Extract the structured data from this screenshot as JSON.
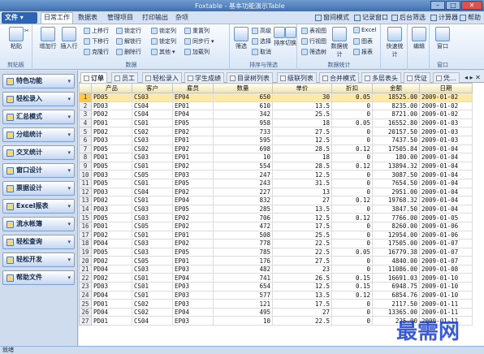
{
  "window": {
    "title": "Foxtable - 基本功能演示Table"
  },
  "menu": {
    "file": "文件",
    "tabs": [
      "日常工作",
      "数据表",
      "管理项目",
      "打印输出",
      "杂项"
    ],
    "right": [
      "窗间模式",
      "记录窗口",
      "后台筛选",
      "计算器",
      "帮助"
    ]
  },
  "ribbon": {
    "clipboard": {
      "paste": "粘贴",
      "label": "剪贴板"
    },
    "data": {
      "add_row": "增加行",
      "insert_row": "插入行",
      "move_up": "上移行",
      "move_down": "下移行",
      "copy_row": "克隆行",
      "lock_row": "锁定行",
      "unlock_row": "解锁行",
      "delete_row": "删除行",
      "lock_col": "锁定列",
      "freeze": "锁定列",
      "other": "其他",
      "reset_col": "重置列",
      "sync": "同步行",
      "encrypt": "加载列",
      "label": "数据"
    },
    "sort_filter": {
      "filter": "筛选",
      "advanced": "高级",
      "select": "选择",
      "cancel": "取消",
      "sort": "排序",
      "switch": "切换",
      "label": "排序与筛选"
    },
    "stats": {
      "table_view": "表视图",
      "row_view": "行视图",
      "filter_tree": "筛选树",
      "data_stats": "数据统计",
      "excel": "Excel",
      "chart": "图表",
      "report": "报表",
      "quick_stats": "快速统计",
      "label": "数据统计"
    },
    "edit": {
      "edit": "编辑"
    },
    "window": {
      "window": "窗口",
      "label": "窗口"
    }
  },
  "sidebar": {
    "items": [
      "特色功能",
      "轻松录入",
      "汇总模式",
      "分组统计",
      "交叉统计",
      "窗口设计",
      "票据设计",
      "Excel报表",
      "流水帐簿",
      "轻松查询",
      "轻松开发",
      "帮助文件"
    ]
  },
  "tables": {
    "tabs": [
      "订单",
      "员工",
      "轻松录入",
      "学生成绩",
      "目录树列表",
      "级联列表",
      "合并模式",
      "多层表头",
      "凭证",
      "凭..."
    ]
  },
  "grid": {
    "columns": [
      "产品",
      "客户",
      "雇员",
      "数量",
      "单价",
      "折扣",
      "金额",
      "日期"
    ],
    "rows": [
      [
        "PD05",
        "CS03",
        "EP04",
        "650",
        "30",
        "0.05",
        "18525.00",
        "2009-01-02"
      ],
      [
        "PD03",
        "CS04",
        "EP01",
        "610",
        "13.5",
        "0",
        "8235.00",
        "2009-01-02"
      ],
      [
        "PD02",
        "CS04",
        "EP04",
        "342",
        "25.5",
        "0",
        "8721.00",
        "2009-01-02"
      ],
      [
        "PD01",
        "CS01",
        "EP05",
        "958",
        "18",
        "0.05",
        "16552.80",
        "2009-01-03"
      ],
      [
        "PD02",
        "CS02",
        "EP02",
        "733",
        "27.5",
        "0",
        "20157.50",
        "2009-01-03"
      ],
      [
        "PD03",
        "CS03",
        "EP01",
        "595",
        "12.5",
        "0",
        "7437.50",
        "2009-01-03"
      ],
      [
        "PD05",
        "CS02",
        "EP02",
        "698",
        "28.5",
        "0.12",
        "17505.84",
        "2009-01-04"
      ],
      [
        "PD01",
        "CS03",
        "EP01",
        "10",
        "18",
        "0",
        "180.00",
        "2009-01-04"
      ],
      [
        "PD05",
        "CS01",
        "EP02",
        "554",
        "28.5",
        "0.12",
        "13894.32",
        "2009-01-04"
      ],
      [
        "PD03",
        "CS05",
        "EP03",
        "247",
        "12.5",
        "0",
        "3087.50",
        "2009-01-04"
      ],
      [
        "PD05",
        "CS01",
        "EP05",
        "243",
        "31.5",
        "0",
        "7654.50",
        "2009-01-04"
      ],
      [
        "PD03",
        "CS04",
        "EP02",
        "227",
        "13",
        "0",
        "2951.00",
        "2009-01-04"
      ],
      [
        "PD02",
        "CS01",
        "EP04",
        "832",
        "27",
        "0.12",
        "19768.32",
        "2009-01-04"
      ],
      [
        "PD03",
        "CS03",
        "EP05",
        "285",
        "13.5",
        "0",
        "3847.50",
        "2009-01-04"
      ],
      [
        "PD05",
        "CS03",
        "EP02",
        "706",
        "12.5",
        "0.12",
        "7766.00",
        "2009-01-05"
      ],
      [
        "PD01",
        "CS05",
        "EP02",
        "472",
        "17.5",
        "0",
        "8260.00",
        "2009-01-06"
      ],
      [
        "PD02",
        "CS01",
        "EP01",
        "508",
        "25.5",
        "0",
        "12954.00",
        "2009-01-06"
      ],
      [
        "PD04",
        "CS03",
        "EP02",
        "778",
        "22.5",
        "0",
        "17505.00",
        "2009-01-07"
      ],
      [
        "PD05",
        "CS03",
        "EP05",
        "785",
        "22.5",
        "0.05",
        "16779.38",
        "2009-01-07"
      ],
      [
        "PD02",
        "CS05",
        "EP01",
        "176",
        "27.5",
        "0",
        "4840.00",
        "2009-01-07"
      ],
      [
        "PD04",
        "CS03",
        "EP03",
        "482",
        "23",
        "0",
        "11086.00",
        "2009-01-08"
      ],
      [
        "PD02",
        "CS01",
        "EP04",
        "741",
        "26.5",
        "0.15",
        "16691.03",
        "2009-01-10"
      ],
      [
        "PD03",
        "CS01",
        "EP03",
        "654",
        "12.5",
        "0.15",
        "6948.75",
        "2009-01-10"
      ],
      [
        "PD04",
        "CS01",
        "EP03",
        "577",
        "13.5",
        "0.12",
        "6854.76",
        "2009-01-10"
      ],
      [
        "PD01",
        "CS02",
        "EP03",
        "121",
        "17.5",
        "0",
        "2117.50",
        "2009-01-11"
      ],
      [
        "PD04",
        "CS02",
        "EP04",
        "495",
        "27",
        "0",
        "13365.00",
        "2009-01-11"
      ],
      [
        "PD01",
        "CS04",
        "EP03",
        "10",
        "22.5",
        "0",
        "225.00",
        "2009-01-11"
      ]
    ]
  },
  "status": {
    "text": "就绪"
  },
  "watermark": "最需网"
}
